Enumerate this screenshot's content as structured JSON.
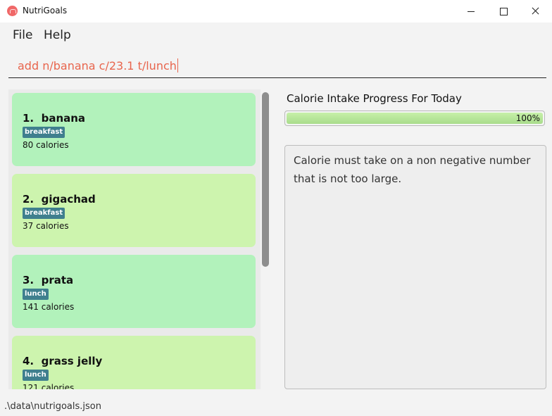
{
  "window": {
    "title": "NutriGoals"
  },
  "menu": {
    "file": "File",
    "help": "Help"
  },
  "command": {
    "value": "add n/banana c/23.1 t/lunch"
  },
  "foods": [
    {
      "index": "1.",
      "name": "banana",
      "tag": "breakfast",
      "calories": "80 calories"
    },
    {
      "index": "2.",
      "name": "gigachad",
      "tag": "breakfast",
      "calories": "37 calories"
    },
    {
      "index": "3.",
      "name": "prata",
      "tag": "lunch",
      "calories": "141 calories"
    },
    {
      "index": "4.",
      "name": "grass jelly",
      "tag": "lunch",
      "calories": "121 calories"
    }
  ],
  "progress": {
    "title": "Calorie Intake Progress For Today",
    "label": "100%",
    "fraction": 1.0
  },
  "result": {
    "message": "Calorie must take on a non negative number that is not too large."
  },
  "status": {
    "path": ".\\data\\nutrigoals.json"
  },
  "colors": {
    "card_even": "#b2f2bb",
    "card_odd": "#cdf4ae",
    "tag": "#3f7f8e",
    "command_text": "#e8654d"
  }
}
